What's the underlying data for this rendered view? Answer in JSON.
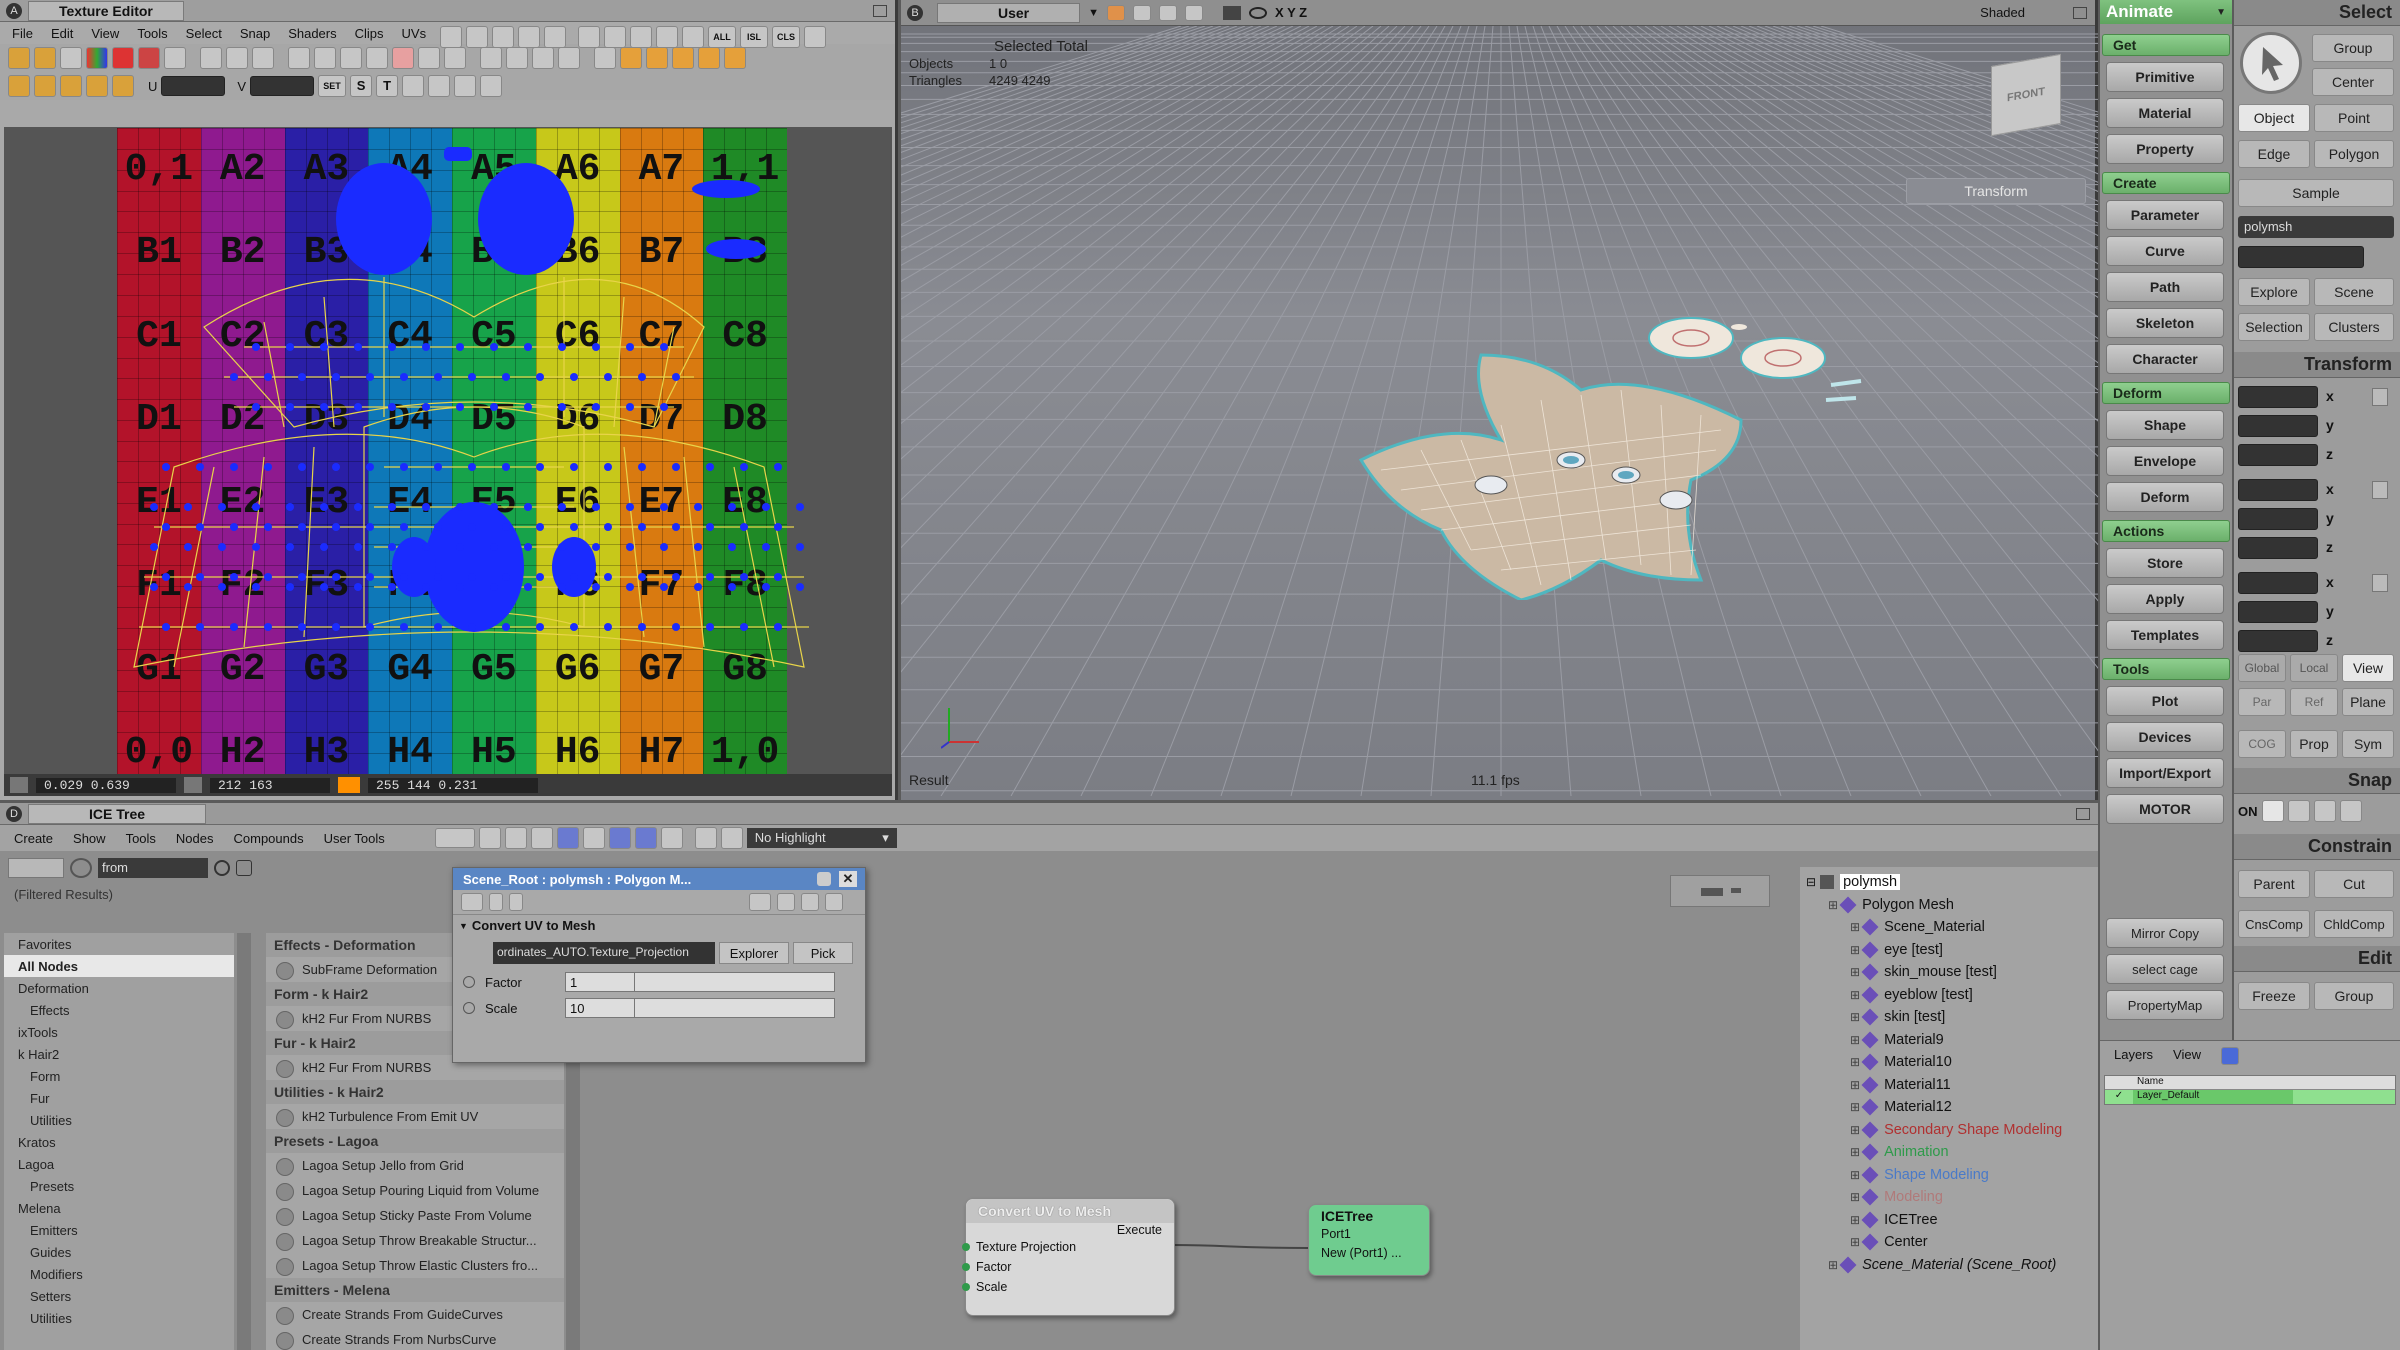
{
  "texture_editor": {
    "letter": "A",
    "title": "Texture Editor",
    "menu": [
      "File",
      "Edit",
      "View",
      "Tools",
      "Select",
      "Snap",
      "Shaders",
      "Clips",
      "UVs"
    ],
    "toolbar_labels": {
      "all": "ALL",
      "isl": "ISL",
      "cls": "CLS",
      "set": "SET",
      "s": "S",
      "t": "T",
      "u": "U",
      "v": "V"
    },
    "grid_labels": [
      [
        "0,1",
        "A2",
        "A3",
        "A4",
        "A5",
        "A6",
        "A7",
        "1,1"
      ],
      [
        "B1",
        "B2",
        "B3",
        "B4",
        "B5",
        "B6",
        "B7",
        "B8"
      ],
      [
        "C1",
        "C2",
        "C3",
        "C4",
        "C5",
        "C6",
        "C7",
        "C8"
      ],
      [
        "D1",
        "D2",
        "D3",
        "D4",
        "D5",
        "D6",
        "D7",
        "D8"
      ],
      [
        "E1",
        "E2",
        "E3",
        "E4",
        "E5",
        "E6",
        "E7",
        "E8"
      ],
      [
        "F1",
        "F2",
        "F3",
        "F4",
        "F5",
        "F6",
        "F7",
        "F8"
      ],
      [
        "G1",
        "G2",
        "G3",
        "G4",
        "G5",
        "G6",
        "G7",
        "G8"
      ],
      [
        "0,0",
        "H2",
        "H3",
        "H4",
        "H5",
        "H6",
        "H7",
        "1,0"
      ]
    ],
    "column_colors": [
      "#b3132a",
      "#8f1a8f",
      "#2a1fa6",
      "#0e78b8",
      "#17a34a",
      "#c7c81a",
      "#d97a10",
      "#1f8a26"
    ],
    "status": {
      "uv": "0.029  0.639",
      "px": "212  163",
      "rgb": "255 144  0.231"
    }
  },
  "viewport": {
    "letter": "B",
    "camera": "User",
    "axes": "X Y Z",
    "mode": "Shaded",
    "stats_header": "Selected Total",
    "objects_label": "Objects",
    "objects_values": "1      0",
    "triangles_label": "Triangles",
    "triangles_values": "4249  4249",
    "cube_label": "FRONT",
    "transform_label": "Transform",
    "result_label": "Result",
    "fps": "11.1 fps"
  },
  "animate_panel": {
    "mode": "Animate",
    "sections": [
      {
        "head": "Get",
        "buttons": [
          "Primitive",
          "Material",
          "Property"
        ]
      },
      {
        "head": "Create",
        "buttons": [
          "Parameter",
          "Curve",
          "Path",
          "Skeleton",
          "Character"
        ]
      },
      {
        "head": "Deform",
        "buttons": [
          "Shape",
          "Envelope",
          "Deform"
        ]
      },
      {
        "head": "Actions",
        "buttons": [
          "Store",
          "Apply",
          "Templates"
        ]
      },
      {
        "head": "Tools",
        "buttons": [
          "Plot",
          "Devices",
          "Import/Export",
          "MOTOR"
        ]
      }
    ],
    "extra_buttons": [
      "Mirror Copy",
      "select cage",
      "PropertyMap"
    ],
    "layers_tab": "Layers",
    "view_tab": "View",
    "layer_name_header": "Name",
    "layer_default": "Layer_Default"
  },
  "select_panel": {
    "title": "Select",
    "group": "Group",
    "center": "Center",
    "object": "Object",
    "point": "Point",
    "edge": "Edge",
    "polygon": "Polygon",
    "sample": "Sample",
    "name_value": "polymsh",
    "explore": "Explore",
    "scene": "Scene",
    "selection": "Selection",
    "clusters": "Clusters",
    "transform_title": "Transform",
    "axis_x": "x",
    "axis_y": "y",
    "axis_z": "z",
    "global": "Global",
    "local": "Local",
    "view": "View",
    "par": "Par",
    "ref": "Ref",
    "plane": "Plane",
    "cog": "COG",
    "prop": "Prop",
    "sym": "Sym",
    "snap_title": "Snap",
    "on": "ON",
    "constrain_title": "Constrain",
    "parent": "Parent",
    "cut": "Cut",
    "cnscomp": "CnsComp",
    "childcomp": "ChldComp",
    "edit_title": "Edit",
    "freeze": "Freeze",
    "edit_group": "Group"
  },
  "ice_tree": {
    "letter": "D",
    "title": "ICE Tree",
    "menu": [
      "Create",
      "Show",
      "Tools",
      "Nodes",
      "Compounds",
      "User Tools"
    ],
    "highlight": "No Highlight",
    "search_value": "from",
    "filtered": "(Filtered Results)",
    "nav": [
      "Favorites",
      "All Nodes",
      "Deformation",
      "Effects",
      "ixTools",
      "k Hair2",
      "Form",
      "Fur",
      "Utilities",
      "Kratos",
      "Lagoa",
      "Presets",
      "Melena",
      "Emitters",
      "Guides",
      "Modifiers",
      "Setters",
      "Utilities"
    ],
    "library": [
      {
        "head": "Effects - Deformation",
        "items": [
          "SubFrame Deformation"
        ]
      },
      {
        "head": "Form - k Hair2",
        "items": [
          "kH2 Fur From NURBS"
        ]
      },
      {
        "head": "Fur - k Hair2",
        "items": [
          "kH2 Fur From NURBS"
        ]
      },
      {
        "head": "Utilities - k Hair2",
        "items": [
          "kH2 Turbulence From Emit UV"
        ]
      },
      {
        "head": "Presets - Lagoa",
        "items": [
          "Lagoa Setup Jello from Grid",
          "Lagoa Setup Pouring Liquid from Volume",
          "Lagoa Setup Sticky Paste From Volume",
          "Lagoa Setup Throw Breakable Structur...",
          "Lagoa Setup Throw Elastic Clusters fro..."
        ]
      },
      {
        "head": "Emitters - Melena",
        "items": [
          "Create Strands From GuideCurves",
          "Create Strands From NurbsCurve"
        ]
      }
    ],
    "ppg": {
      "title": "Scene_Root : polymsh : Polygon M...",
      "section": "Convert UV to Mesh",
      "projection": "ordinates_AUTO.Texture_Projection",
      "explorer": "Explorer",
      "pick": "Pick",
      "factor_label": "Factor",
      "factor_value": "1",
      "scale_label": "Scale",
      "scale_value": "10"
    },
    "node_convert": {
      "title": "Convert UV to Mesh",
      "execute": "Execute",
      "ports": [
        "Texture Projection",
        "Factor",
        "Scale"
      ]
    },
    "node_icetree": {
      "title": "ICETree",
      "ports": [
        "Port1",
        "New (Port1) ..."
      ]
    },
    "tree": {
      "root": "polymsh",
      "items": [
        {
          "label": "Polygon Mesh",
          "indent": 1,
          "color": "#111"
        },
        {
          "label": "Scene_Material",
          "indent": 2,
          "color": "#111"
        },
        {
          "label": "eye [test]",
          "indent": 2,
          "color": "#111"
        },
        {
          "label": "skin_mouse [test]",
          "indent": 2,
          "color": "#111"
        },
        {
          "label": "eyeblow [test]",
          "indent": 2,
          "color": "#111"
        },
        {
          "label": "skin [test]",
          "indent": 2,
          "color": "#111"
        },
        {
          "label": "Material9",
          "indent": 2,
          "color": "#111"
        },
        {
          "label": "Material10",
          "indent": 2,
          "color": "#111"
        },
        {
          "label": "Material11",
          "indent": 2,
          "color": "#111"
        },
        {
          "label": "Material12",
          "indent": 2,
          "color": "#111"
        },
        {
          "label": "Secondary Shape Modeling",
          "indent": 2,
          "color": "#b03030"
        },
        {
          "label": "Animation",
          "indent": 2,
          "color": "#2e9a4a"
        },
        {
          "label": "Shape Modeling",
          "indent": 2,
          "color": "#4a7ac8"
        },
        {
          "label": "Modeling",
          "indent": 2,
          "color": "#b07a7a"
        },
        {
          "label": "ICETree",
          "indent": 2,
          "color": "#111"
        },
        {
          "label": "Center",
          "indent": 2,
          "color": "#111"
        },
        {
          "label": "Scene_Material (Scene_Root)",
          "indent": 1,
          "color": "#111"
        }
      ]
    }
  }
}
